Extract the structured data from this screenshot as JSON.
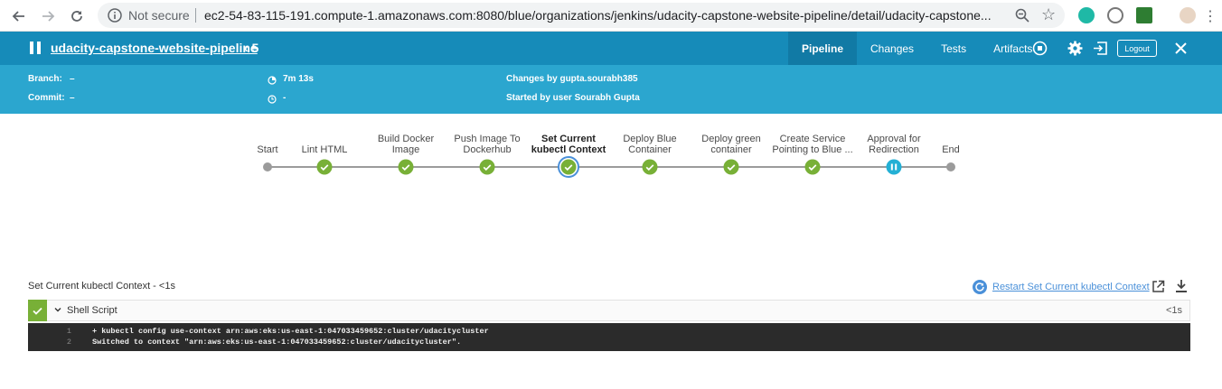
{
  "browser": {
    "security_label": "Not secure",
    "url": "ec2-54-83-115-191.compute-1.amazonaws.com:8080/blue/organizations/jenkins/udacity-capstone-website-pipeline/detail/udacity-capstone..."
  },
  "header": {
    "pipeline_name": "udacity-capstone-website-pipeline",
    "run_number": "‹ 5",
    "tabs": [
      "Pipeline",
      "Changes",
      "Tests",
      "Artifacts"
    ],
    "active_tab": "Pipeline",
    "logout_label": "Logout"
  },
  "info": {
    "branch_label": "Branch:",
    "branch_value": "–",
    "commit_label": "Commit:",
    "commit_value": "–",
    "duration": "7m 13s",
    "ended": "-",
    "changes_by": "Changes by gupta.sourabh385",
    "started_by": "Started by user Sourabh Gupta"
  },
  "stages": [
    {
      "label": "Start",
      "status": "start"
    },
    {
      "label": "Lint HTML",
      "status": "success"
    },
    {
      "label": "Build Docker\nImage",
      "status": "success"
    },
    {
      "label": "Push Image To\nDockerhub",
      "status": "success"
    },
    {
      "label": "Set Current\nkubectl Context",
      "status": "success",
      "selected": true
    },
    {
      "label": "Deploy Blue\nContainer",
      "status": "success"
    },
    {
      "label": "Deploy green\ncontainer",
      "status": "success"
    },
    {
      "label": "Create Service\nPointing to Blue ...",
      "status": "success"
    },
    {
      "label": "Approval for\nRedirection",
      "status": "paused"
    },
    {
      "label": "End",
      "status": "end"
    }
  ],
  "log": {
    "title": "Set Current kubectl Context - <1s",
    "restart_label": "Restart Set Current kubectl Context",
    "step_name": "Shell Script",
    "step_duration": "<1s",
    "lines": [
      {
        "num": "1",
        "text": "+ kubectl config use-context arn:aws:eks:us-east-1:047033459652:cluster/udacitycluster"
      },
      {
        "num": "2",
        "text": "Switched to context \"arn:aws:eks:us-east-1:047033459652:cluster/udacitycluster\"."
      }
    ]
  },
  "colors": {
    "header_bg": "#168bb9",
    "infoband_bg": "#2ba6cf",
    "success": "#78b037",
    "running": "#24b0d5"
  }
}
